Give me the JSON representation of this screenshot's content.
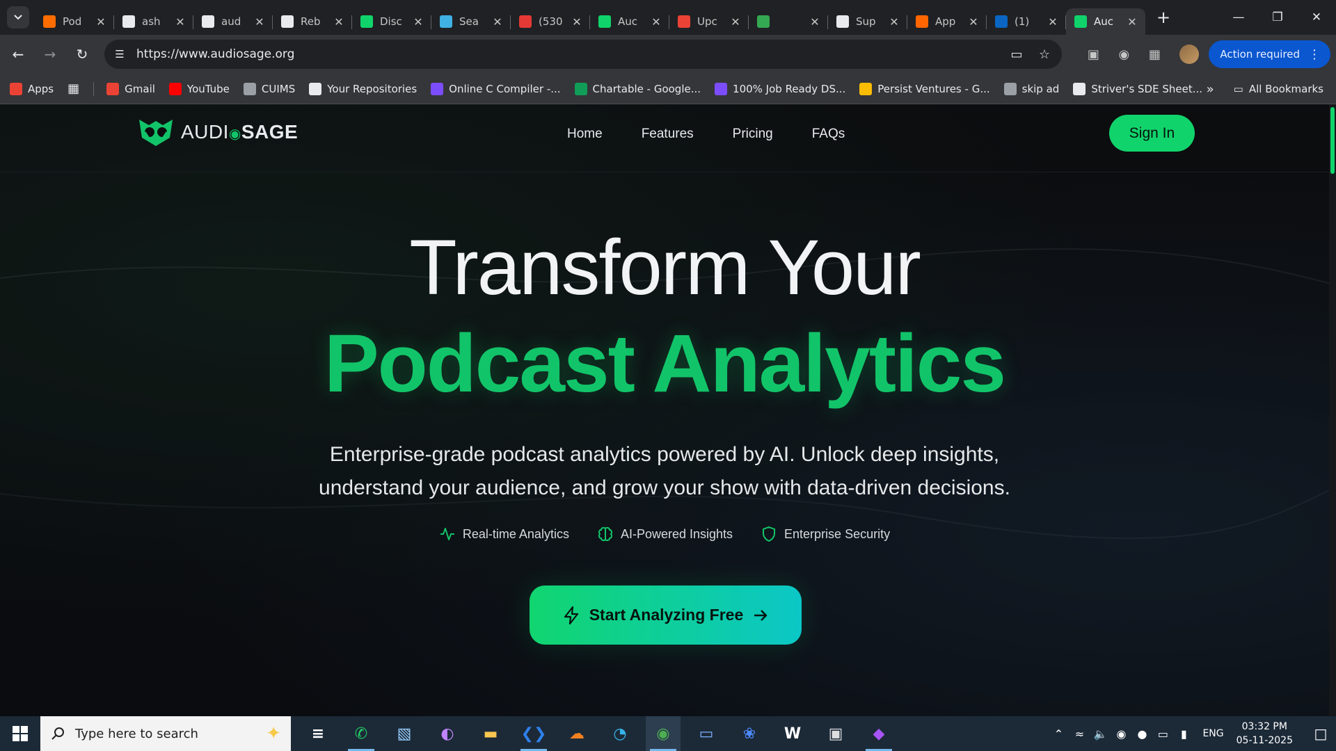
{
  "browser": {
    "tabs": [
      {
        "title": "Pod",
        "icon": "fire-icon",
        "color": "#ff6d00"
      },
      {
        "title": "ash",
        "icon": "github-icon",
        "color": "#e8eaed"
      },
      {
        "title": "aud",
        "icon": "triangle-icon",
        "color": "#e8eaed"
      },
      {
        "title": "Reb",
        "icon": "notion-icon",
        "color": "#e8eaed"
      },
      {
        "title": "Disc",
        "icon": "audiosage-icon",
        "color": "#10d46b"
      },
      {
        "title": "Sea",
        "icon": "search-console-icon",
        "color": "#3fb1e3"
      },
      {
        "title": "(530",
        "icon": "badge-icon",
        "color": "#e53935"
      },
      {
        "title": "Auc",
        "icon": "audiosage-icon",
        "color": "#10d46b"
      },
      {
        "title": "Upc",
        "icon": "gmail-icon",
        "color": "#ea4335"
      },
      {
        "title": "",
        "icon": "meet-icon",
        "color": "#34a853"
      },
      {
        "title": "Sup",
        "icon": "support-icon",
        "color": "#e8eaed"
      },
      {
        "title": "App",
        "icon": "ycombinator-icon",
        "color": "#ff6600"
      },
      {
        "title": "(1)",
        "icon": "linkedin-icon",
        "color": "#0a66c2"
      },
      {
        "title": "Auc",
        "icon": "audiosage-icon",
        "color": "#10d46b",
        "active": true
      }
    ],
    "url": "https://www.audiosage.org",
    "action_required": "Action required",
    "bookmarks": [
      {
        "label": "Apps",
        "icon": "apps-grid-icon",
        "color": "#ea4335"
      },
      {
        "label": "Gmail",
        "icon": "gmail-icon",
        "color": "#ea4335"
      },
      {
        "label": "YouTube",
        "icon": "youtube-icon",
        "color": "#ff0000"
      },
      {
        "label": "CUIMS",
        "icon": "globe-icon",
        "color": "#9aa0a6"
      },
      {
        "label": "Your Repositories",
        "icon": "github-icon",
        "color": "#e8eaed"
      },
      {
        "label": "Online C Compiler -...",
        "icon": "bolt-icon",
        "color": "#7c4dff"
      },
      {
        "label": "Chartable - Google...",
        "icon": "sheets-icon",
        "color": "#0f9d58"
      },
      {
        "label": "100% Job Ready DS...",
        "icon": "shield-icon",
        "color": "#7c4dff"
      },
      {
        "label": "Persist Ventures - G...",
        "icon": "drive-icon",
        "color": "#fbbc04"
      },
      {
        "label": "skip ad",
        "icon": "globe-icon",
        "color": "#9aa0a6"
      },
      {
        "label": "Striver's SDE Sheet...",
        "icon": "tuf-icon",
        "color": "#e8eaed"
      }
    ],
    "all_bookmarks": "All Bookmarks"
  },
  "site": {
    "brand_light": "AUDI",
    "brand_mid": "◉",
    "brand_bold": "SAGE",
    "nav": [
      "Home",
      "Features",
      "Pricing",
      "FAQs"
    ],
    "signin": "Sign In",
    "hero_line1": "Transform Your",
    "hero_line2": "Podcast Analytics",
    "subtitle": "Enterprise-grade podcast analytics powered by AI. Unlock deep insights, understand your audience, and grow your show with data-driven decisions.",
    "features": [
      {
        "label": "Real-time Analytics",
        "icon": "activity-icon"
      },
      {
        "label": "AI-Powered Insights",
        "icon": "brain-icon"
      },
      {
        "label": "Enterprise Security",
        "icon": "shield-icon"
      }
    ],
    "cta": "Start Analyzing Free",
    "accent": "#10d46b",
    "accent2": "#0bc7c6"
  },
  "taskbar": {
    "search_placeholder": "Type here to search",
    "apps": [
      {
        "name": "task-view",
        "glyph": "≡",
        "color": "#ffffff"
      },
      {
        "name": "whatsapp",
        "glyph": "✆",
        "color": "#25d366",
        "open": true
      },
      {
        "name": "notes",
        "glyph": "▧",
        "color": "#9ad0ff"
      },
      {
        "name": "copilot",
        "glyph": "◐",
        "color": "#c084fc"
      },
      {
        "name": "file-explorer",
        "glyph": "▬",
        "color": "#f9c74f"
      },
      {
        "name": "vscode",
        "glyph": "❮❯",
        "color": "#2f80ed",
        "open": true
      },
      {
        "name": "cloudflare",
        "glyph": "☁",
        "color": "#f48120"
      },
      {
        "name": "edge",
        "glyph": "◔",
        "color": "#36b3e8"
      },
      {
        "name": "chrome",
        "glyph": "◉",
        "color": "#4caf50",
        "open": true,
        "active": true
      },
      {
        "name": "remote-desktop",
        "glyph": "▭",
        "color": "#7fb2ff"
      },
      {
        "name": "network-app",
        "glyph": "❀",
        "color": "#4d8bff"
      },
      {
        "name": "wpm",
        "glyph": "W",
        "color": "#ffffff"
      },
      {
        "name": "terminal-box",
        "glyph": "▣",
        "color": "#dddddd"
      },
      {
        "name": "messenger",
        "glyph": "◆",
        "color": "#a855f7",
        "open": true
      }
    ],
    "lang": "ENG",
    "time": "03:32 PM",
    "date": "05-11-2025"
  }
}
